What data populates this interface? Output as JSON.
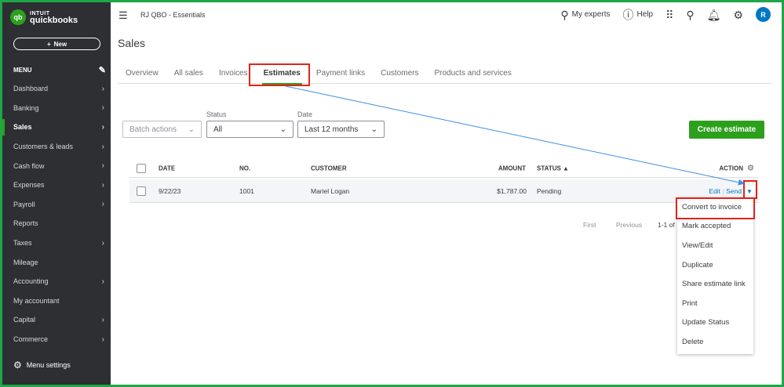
{
  "app": {
    "logo_brand": "INTUIT",
    "logo_name": "quickbooks",
    "company": "RJ QBO - Essentials"
  },
  "sidebar": {
    "new_label": "New",
    "menu_label": "MENU",
    "items": [
      {
        "label": "Dashboard",
        "chevron": true
      },
      {
        "label": "Banking",
        "chevron": true
      },
      {
        "label": "Sales",
        "chevron": true,
        "active": true
      },
      {
        "label": "Customers & leads",
        "chevron": true
      },
      {
        "label": "Cash flow",
        "chevron": true
      },
      {
        "label": "Expenses",
        "chevron": true
      },
      {
        "label": "Payroll",
        "chevron": true
      },
      {
        "label": "Reports",
        "chevron": false
      },
      {
        "label": "Taxes",
        "chevron": true
      },
      {
        "label": "Mileage",
        "chevron": false
      },
      {
        "label": "Accounting",
        "chevron": true
      },
      {
        "label": "My accountant",
        "chevron": false
      },
      {
        "label": "Capital",
        "chevron": true
      },
      {
        "label": "Commerce",
        "chevron": true
      }
    ],
    "menu_settings": "Menu settings"
  },
  "topbar": {
    "my_experts": "My experts",
    "help": "Help",
    "avatar_initial": "R"
  },
  "page": {
    "title": "Sales"
  },
  "tabs": [
    "Overview",
    "All sales",
    "Invoices",
    "Estimates",
    "Payment links",
    "Customers",
    "Products and services"
  ],
  "filters": {
    "batch_actions": "Batch actions",
    "status_label": "Status",
    "status_value": "All",
    "date_label": "Date",
    "date_value": "Last 12 months",
    "create_button": "Create estimate"
  },
  "table": {
    "headers": {
      "date": "DATE",
      "no": "NO.",
      "customer": "CUSTOMER",
      "amount": "AMOUNT",
      "status": "STATUS ▲",
      "action": "ACTION"
    },
    "row": {
      "date": "9/22/23",
      "no": "1001",
      "customer": "Mariel Logan",
      "amount": "$1,787.00",
      "status": "Pending",
      "edit": "Edit",
      "send": "Send"
    }
  },
  "pager": {
    "first": "First",
    "previous": "Previous",
    "range": "1-1 of"
  },
  "action_menu": [
    "Convert to invoice",
    "Mark accepted",
    "View/Edit",
    "Duplicate",
    "Share estimate link",
    "Print",
    "Update Status",
    "Delete"
  ],
  "colors": {
    "brand_green": "#2ca01c",
    "link_blue": "#0077c5",
    "highlight_red": "#e2231a",
    "frame_green": "#1fa64a"
  }
}
